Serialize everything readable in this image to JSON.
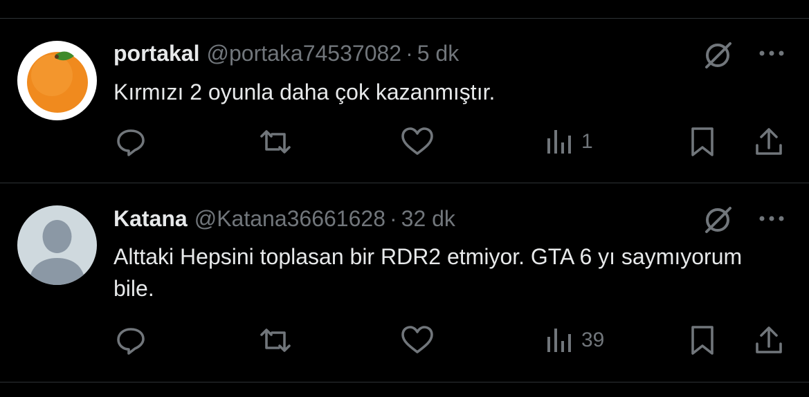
{
  "tweets": [
    {
      "name": "portakal",
      "handle": "@portaka74537082",
      "separator": "·",
      "time": "5 dk",
      "text": "Kırmızı 2 oyunla daha çok kazanmıştır.",
      "views": "1",
      "avatar": "orange-fruit-avatar"
    },
    {
      "name": "Katana",
      "handle": "@Katana36661628",
      "separator": "·",
      "time": "32 dk",
      "text": "Alttaki Hepsini toplasan bir RDR2 etmiyor. GTA 6 yı saymıyorum bile.",
      "views": "39",
      "avatar": "default-profile-avatar"
    }
  ],
  "icons": {
    "grok": "grok-slash-circle-icon",
    "more": "more-dots-icon",
    "reply": "reply-bubble-icon",
    "retweet": "retweet-arrows-icon",
    "like": "heart-icon",
    "views": "bar-chart-icon",
    "bookmark": "bookmark-icon",
    "share": "share-upload-icon"
  },
  "colors": {
    "background": "#000000",
    "text_primary": "#e7e9ea",
    "text_secondary": "#71767b",
    "divider": "#2f3336"
  }
}
